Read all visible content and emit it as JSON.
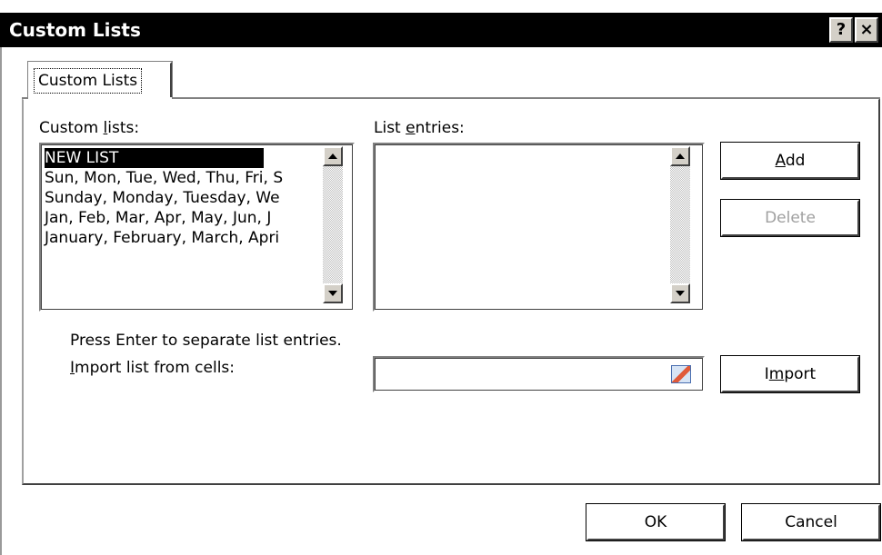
{
  "window": {
    "title": "Custom Lists",
    "help_glyph": "?",
    "close_glyph": "×"
  },
  "tab": {
    "label": "Custom Lists"
  },
  "custom_lists": {
    "label_pre": "Custom ",
    "label_u": "l",
    "label_post": "ists:",
    "items": [
      "NEW LIST",
      "Sun, Mon, Tue, Wed, Thu, Fri, S",
      "Sunday, Monday, Tuesday, We",
      "Jan, Feb, Mar, Apr, May, Jun, J",
      "January, February, March, Apri"
    ],
    "selected_index": 0
  },
  "list_entries": {
    "label_pre": "List ",
    "label_u": "e",
    "label_post": "ntries:",
    "value": ""
  },
  "buttons": {
    "add": {
      "u": "A",
      "rest": "dd"
    },
    "delete": "Delete",
    "import": {
      "pre": "I",
      "u": "m",
      "post": "port"
    },
    "ok": "OK",
    "cancel": "Cancel"
  },
  "hint": "Press Enter to separate list entries.",
  "import_label": {
    "u": "I",
    "rest": "mport list from cells:"
  },
  "import_value": "",
  "icons": {
    "scroll_up": "scroll-up-arrow-icon",
    "scroll_down": "scroll-down-arrow-icon",
    "range_select": "range-select-icon"
  }
}
